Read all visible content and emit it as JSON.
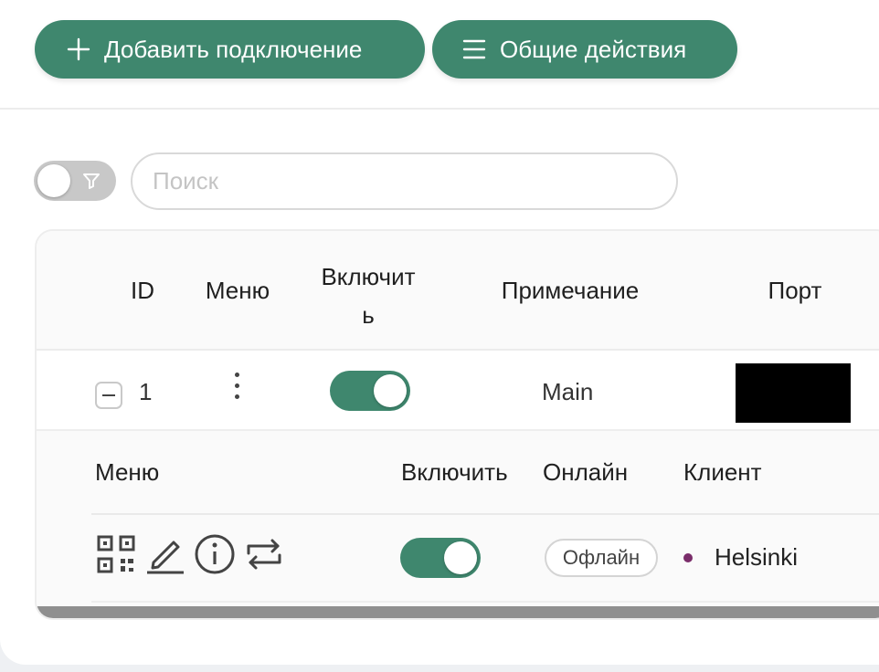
{
  "toolbar": {
    "add_label": "Добавить подключение",
    "common_label": "Общие действия"
  },
  "search": {
    "placeholder": "Поиск",
    "value": ""
  },
  "filter_toggle": {
    "icon": "filter-icon",
    "on": false
  },
  "table": {
    "columns": [
      "ID",
      "Меню",
      "Включить",
      "Примечание",
      "Порт"
    ],
    "rows": [
      {
        "id": "1",
        "enabled": true,
        "remark": "Main",
        "port": ""
      }
    ]
  },
  "subtable": {
    "columns": [
      "Меню",
      "Включить",
      "Онлайн",
      "Клиент"
    ],
    "rows": [
      {
        "actions": [
          "qr-code-icon",
          "edit-icon",
          "info-icon",
          "reset-traffic-icon"
        ],
        "enabled": true,
        "online": "Офлайн",
        "client": "Helsinki"
      }
    ]
  },
  "colors": {
    "accent": "#3f876e",
    "client_dot": "#7a2d6a"
  }
}
